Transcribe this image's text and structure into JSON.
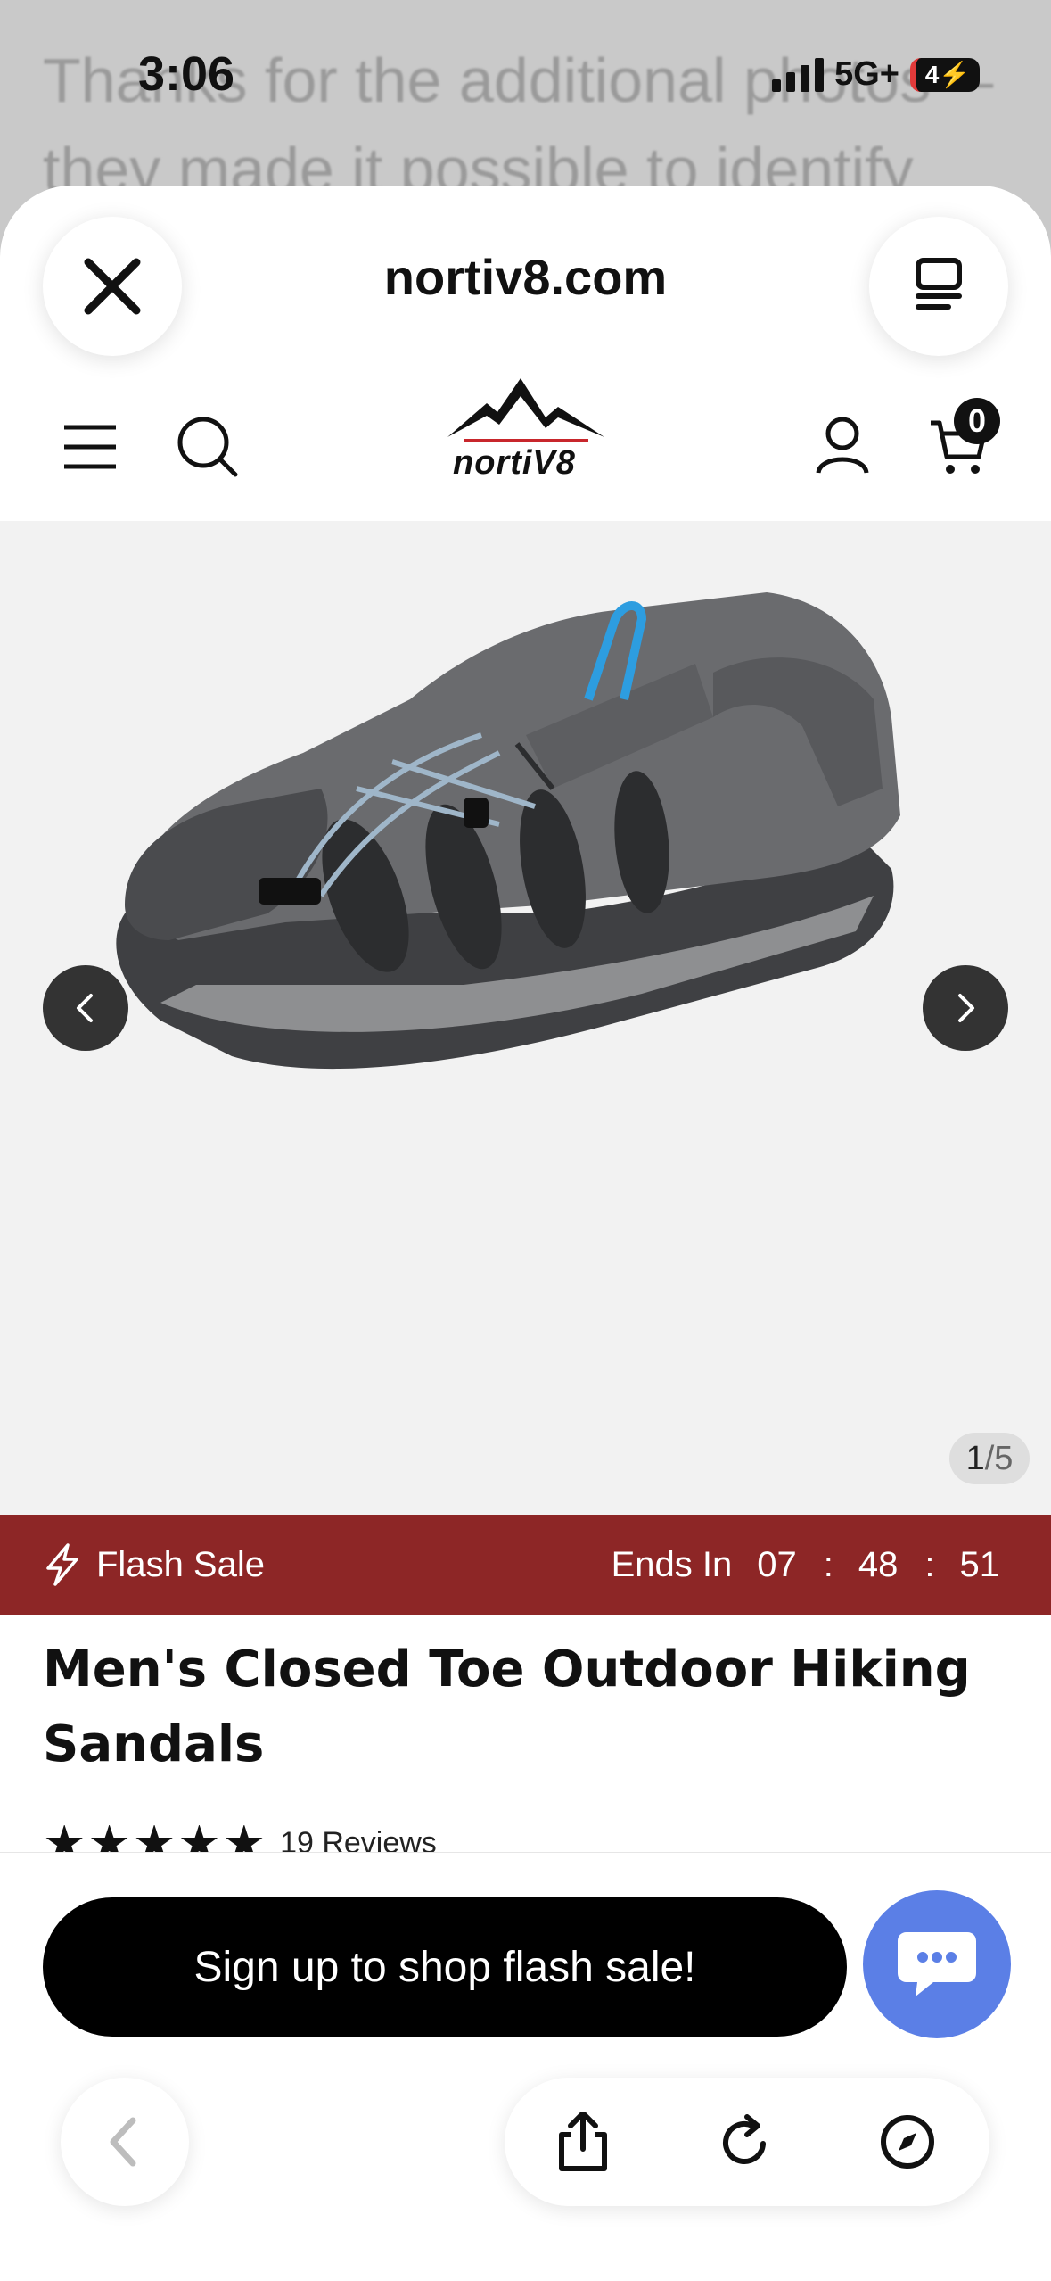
{
  "background_page": {
    "text_line_1": "Thanks for the additional photos—",
    "text_line_2": "they made it possible to identify"
  },
  "status_bar": {
    "time": "3:06",
    "network": "5G+",
    "battery": "4"
  },
  "sheet": {
    "domain": "nortiv8.com"
  },
  "site": {
    "logo_text": "nortiV8",
    "cart_count": "0"
  },
  "gallery": {
    "current": "1",
    "total": "/5"
  },
  "flash_sale": {
    "label": "Flash Sale",
    "ends_in": "Ends In",
    "hours": "07",
    "minutes": "48",
    "seconds": "51",
    "separator": ":"
  },
  "product": {
    "title": "Men's Closed Toe Outdoor Hiking Sandals",
    "stars": "★★★★★",
    "reviews": "19 Reviews"
  },
  "cta": {
    "signup_label": "Sign up to shop flash sale!"
  },
  "colors": {
    "flash_bar": "#8d2626",
    "chat_button": "#5b7fe6",
    "signup_button": "#000000"
  }
}
